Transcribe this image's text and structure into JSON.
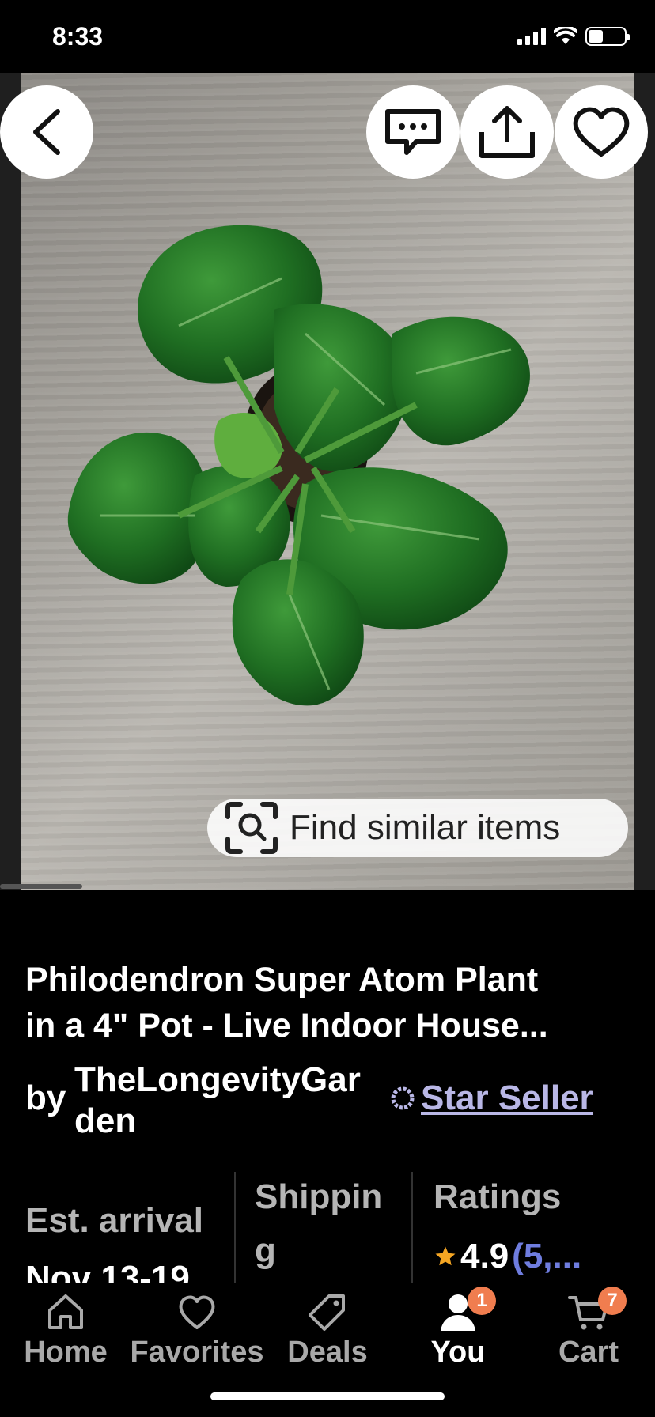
{
  "status_bar": {
    "time": "8:33"
  },
  "header_buttons": {
    "back": "back",
    "message": "message",
    "share": "share",
    "favorite": "favorite"
  },
  "image": {
    "find_similar_label": "Find similar items"
  },
  "product": {
    "title_line1": "Philodendron Super Atom Plant",
    "title_line2": "in a 4\" Pot - Live Indoor House...",
    "by_label": "by",
    "shop_name_line1": "TheLongevityGar",
    "shop_name_line2": "den",
    "star_seller_label": "Star Seller"
  },
  "stats": {
    "arrival_label": "Est. arrival",
    "arrival_value": "Nov 13-19",
    "shipping_label_line1": "Shippin",
    "shipping_label_line2": "g",
    "ratings_label": "Ratings",
    "rating_value": "4.9",
    "rating_count": "(5,..."
  },
  "tabbar": {
    "items": [
      {
        "label": "Home",
        "icon": "home-icon"
      },
      {
        "label": "Favorites",
        "icon": "heart-icon"
      },
      {
        "label": "Deals",
        "icon": "tag-icon"
      },
      {
        "label": "You",
        "icon": "person-icon",
        "badge": "1"
      },
      {
        "label": "Cart",
        "icon": "cart-icon",
        "badge": "7"
      }
    ]
  },
  "colors": {
    "accent_badge": "#f07d4f",
    "star_seller": "#b9b7e6",
    "rating_count": "#6f7ddf",
    "star": "#f5a623"
  }
}
